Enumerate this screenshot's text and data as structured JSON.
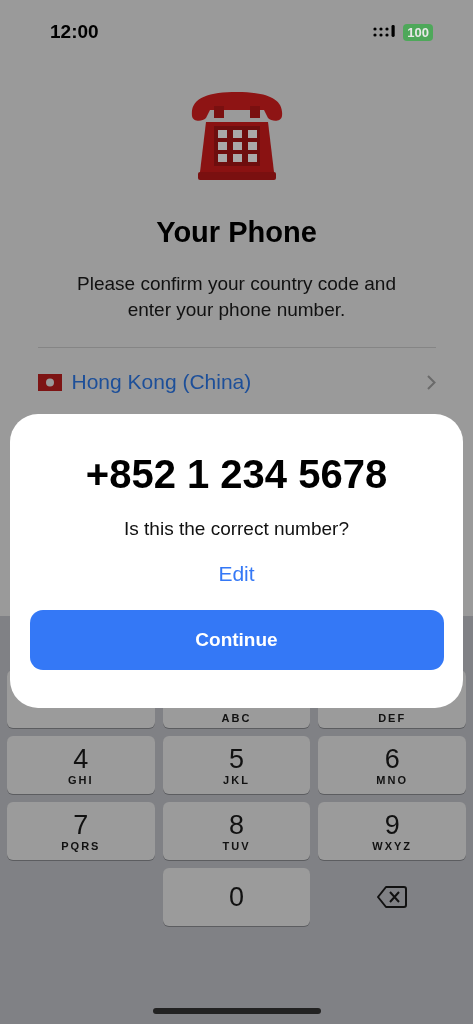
{
  "status_bar": {
    "time": "12:00",
    "battery": "100"
  },
  "title": "Your Phone",
  "subtitle": "Please confirm your country code and enter your phone number.",
  "country": {
    "name": "Hong Kong (China)"
  },
  "dialog": {
    "number": "+852 1 234 5678",
    "question": "Is this the correct number?",
    "edit": "Edit",
    "continue": "Continue"
  },
  "keypad": [
    {
      "kind": "digit"
    },
    {
      "kind": "digit",
      "letters": "ABC"
    },
    {
      "kind": "digit",
      "letters": "DEF"
    },
    {
      "kind": "digit",
      "digit": "4",
      "letters": "GHI"
    },
    {
      "kind": "digit",
      "digit": "5",
      "letters": "JKL"
    },
    {
      "kind": "digit",
      "digit": "6",
      "letters": "MNO"
    },
    {
      "kind": "digit",
      "digit": "7",
      "letters": "PQRS"
    },
    {
      "kind": "digit",
      "digit": "8",
      "letters": "TUV"
    },
    {
      "kind": "digit",
      "digit": "9",
      "letters": "WXYZ"
    },
    {
      "kind": "blank"
    },
    {
      "kind": "digit",
      "digit": "0"
    },
    {
      "kind": "delete"
    }
  ]
}
